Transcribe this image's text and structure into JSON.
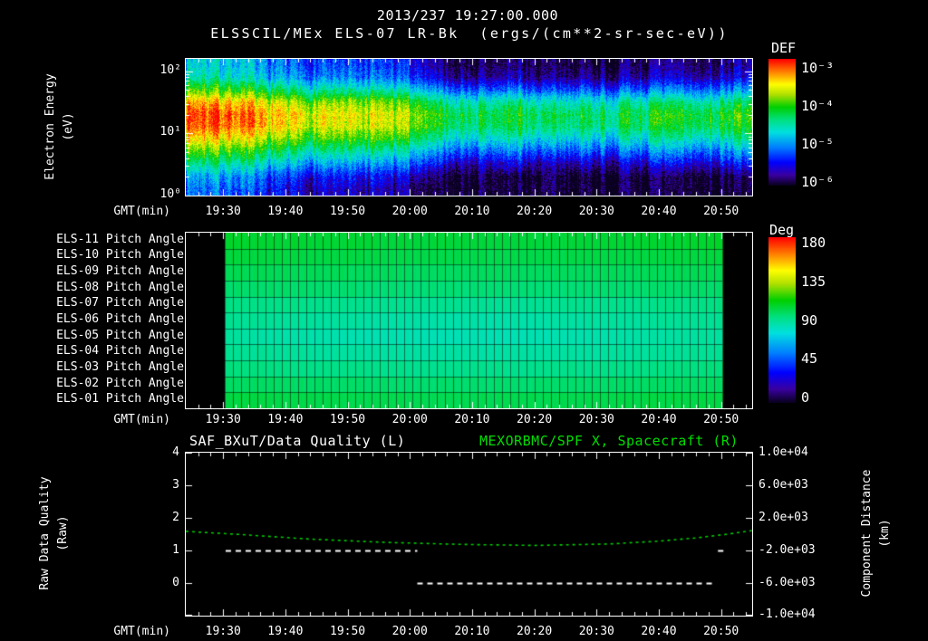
{
  "page": {
    "background": "#000000",
    "text_color": "#ffffff",
    "green": "#00dd00"
  },
  "header": {
    "datetime": "2013/237 19:27:00.000",
    "spectrogram_title": "ELSSCIL/MEx ELS-07 LR-Bk  (ergs/(cm**2-sr-sec-eV))"
  },
  "axes": {
    "time_label": "GMT(min)",
    "time_domain_minutes_after_1900": [
      24,
      115
    ],
    "time_tick_minutes": [
      30,
      40,
      50,
      60,
      70,
      80,
      90,
      100,
      110
    ],
    "time_ticks": [
      "19:30",
      "19:40",
      "19:50",
      "20:00",
      "20:10",
      "20:20",
      "20:30",
      "20:40",
      "20:50"
    ]
  },
  "spectrogram": {
    "ylabel": "Electron Energy\n(eV)",
    "y_ticks": [
      "10²",
      "10¹",
      "10⁰"
    ],
    "colorbar": {
      "label": "DEF",
      "ticks": [
        "10⁻³",
        "10⁻⁴",
        "10⁻⁵",
        "10⁻⁶"
      ]
    }
  },
  "pitch": {
    "row_labels": [
      "ELS-11 Pitch Angle",
      "ELS-10 Pitch Angle",
      "ELS-09 Pitch Angle",
      "ELS-08 Pitch Angle",
      "ELS-07 Pitch Angle",
      "ELS-06 Pitch Angle",
      "ELS-05 Pitch Angle",
      "ELS-04 Pitch Angle",
      "ELS-03 Pitch Angle",
      "ELS-02 Pitch Angle",
      "ELS-01 Pitch Angle"
    ],
    "colorbar": {
      "label": "Deg",
      "ticks": [
        "180",
        "135",
        "90",
        "45",
        "0"
      ]
    }
  },
  "quality": {
    "title_left": "SAF_BXuT/Data Quality (L)",
    "title_right": "MEXORBMC/SPF X, Spacecraft (R)",
    "ylabel_left": "Raw Data Quality\n(Raw)",
    "ylabel_right": "Component Distance\n(km)",
    "left_ticks": [
      "4",
      "3",
      "2",
      "1",
      "0"
    ],
    "right_ticks": [
      "1.0e+04",
      "6.0e+03",
      "2.0e+03",
      "-2.0e+03",
      "-6.0e+03",
      "-1.0e+04"
    ]
  },
  "colors": {
    "colormap": [
      [
        0.0,
        "#0a0020"
      ],
      [
        0.08,
        "#3a00a0"
      ],
      [
        0.18,
        "#0000ff"
      ],
      [
        0.3,
        "#0080ff"
      ],
      [
        0.42,
        "#00e0e0"
      ],
      [
        0.52,
        "#00e080"
      ],
      [
        0.62,
        "#00d000"
      ],
      [
        0.72,
        "#b0e000"
      ],
      [
        0.8,
        "#ffff00"
      ],
      [
        0.9,
        "#ff8000"
      ],
      [
        1.0,
        "#ff0000"
      ]
    ],
    "quality_line": "#ffffff",
    "distance_line": "#00cc00"
  },
  "chart_data": [
    {
      "type": "heatmap",
      "name": "electron_energy_spectrogram",
      "title": "ELSSCIL/MEx ELS-07 LR-Bk",
      "units": "ergs/(cm**2-sr-sec-eV)",
      "xlabel": "GMT(min)",
      "ylabel": "Electron Energy (eV)",
      "y_scale": "log",
      "ylim_log10_ev": [
        0,
        2.2
      ],
      "x_range_minutes_after_1900": [
        24,
        115
      ],
      "colorbar_label": "DEF",
      "colorbar_ticks_log10": [
        -3,
        -4,
        -5,
        -6
      ],
      "row_log10_energy": [
        2.1,
        1.9,
        1.7,
        1.5,
        1.3,
        1.1,
        0.9,
        0.7,
        0.5,
        0.3,
        0.1
      ],
      "values_log10_def": [
        [
          -4.9,
          -5.0,
          -5.3,
          -5.5,
          -5.5,
          -5.6,
          -5.6,
          -5.8,
          -6.2,
          -6.3,
          -6.1,
          -6.3,
          -6.2,
          -6.3,
          -6.2,
          -6.1,
          -6.2,
          -6.0
        ],
        [
          -4.7,
          -4.8,
          -5.1,
          -5.3,
          -5.3,
          -5.4,
          -5.4,
          -5.6,
          -6.0,
          -6.1,
          -5.9,
          -6.2,
          -6.0,
          -6.1,
          -6.0,
          -5.9,
          -6.0,
          -5.8
        ],
        [
          -4.1,
          -4.2,
          -4.5,
          -4.7,
          -4.7,
          -4.8,
          -4.8,
          -5.0,
          -5.4,
          -5.5,
          -5.3,
          -5.6,
          -5.4,
          -5.5,
          -5.4,
          -5.3,
          -5.4,
          -5.2
        ],
        [
          -3.4,
          -3.5,
          -3.8,
          -4.0,
          -4.0,
          -4.1,
          -4.1,
          -4.3,
          -4.7,
          -4.8,
          -4.6,
          -4.9,
          -4.7,
          -4.8,
          -4.7,
          -4.6,
          -4.7,
          -4.5
        ],
        [
          -3.1,
          -3.2,
          -3.5,
          -3.7,
          -3.7,
          -3.8,
          -3.8,
          -4.0,
          -4.4,
          -4.5,
          -4.3,
          -4.6,
          -4.4,
          -4.5,
          -4.4,
          -4.3,
          -4.4,
          -4.2
        ],
        [
          -3.2,
          -3.3,
          -3.6,
          -3.8,
          -3.8,
          -3.9,
          -3.9,
          -4.1,
          -4.5,
          -4.6,
          -4.4,
          -4.7,
          -4.5,
          -4.6,
          -4.5,
          -4.4,
          -4.5,
          -4.3
        ],
        [
          -3.6,
          -3.7,
          -4.0,
          -4.2,
          -4.2,
          -4.3,
          -4.3,
          -4.5,
          -4.9,
          -5.0,
          -4.8,
          -5.1,
          -4.9,
          -5.0,
          -4.9,
          -4.8,
          -4.9,
          -4.7
        ],
        [
          -4.1,
          -4.2,
          -4.5,
          -4.7,
          -4.7,
          -4.8,
          -4.8,
          -5.0,
          -5.4,
          -5.5,
          -5.3,
          -5.6,
          -5.4,
          -5.5,
          -5.4,
          -5.3,
          -5.4,
          -5.2
        ],
        [
          -4.6,
          -4.7,
          -5.0,
          -5.2,
          -5.2,
          -5.3,
          -5.3,
          -5.5,
          -5.9,
          -6.0,
          -5.8,
          -6.1,
          -5.9,
          -6.0,
          -5.9,
          -5.8,
          -5.9,
          -5.7
        ],
        [
          -5.1,
          -5.2,
          -5.5,
          -5.7,
          -5.7,
          -5.8,
          -5.8,
          -6.0,
          -6.3,
          -6.3,
          -6.3,
          -6.3,
          -6.3,
          -6.3,
          -6.3,
          -6.3,
          -6.3,
          -6.2
        ],
        [
          -5.3,
          -5.4,
          -5.7,
          -5.9,
          -5.9,
          -6.0,
          -6.0,
          -6.2,
          -6.3,
          -6.3,
          -6.3,
          -6.3,
          -6.3,
          -6.3,
          -6.3,
          -6.3,
          -6.3,
          -6.3
        ]
      ]
    },
    {
      "type": "heatmap",
      "name": "pitch_angles",
      "units": "Deg",
      "colorbar_range_deg": [
        0,
        180
      ],
      "data_t_range": [
        30.2,
        110.2
      ],
      "sample_t": [
        30,
        46,
        62,
        78,
        94,
        110
      ],
      "values_deg": [
        [
          105,
          104,
          103,
          103,
          104,
          105
        ],
        [
          103,
          102,
          101,
          101,
          102,
          103
        ],
        [
          100,
          99,
          98,
          98,
          99,
          100
        ],
        [
          97,
          96,
          95,
          95,
          96,
          97
        ],
        [
          93,
          91,
          90,
          90,
          91,
          93
        ],
        [
          90,
          88,
          86,
          86,
          88,
          90
        ],
        [
          88,
          85,
          84,
          84,
          86,
          88
        ],
        [
          90,
          88,
          87,
          87,
          88,
          90
        ],
        [
          94,
          92,
          91,
          91,
          92,
          94
        ],
        [
          98,
          97,
          96,
          96,
          97,
          98
        ],
        [
          102,
          101,
          100,
          100,
          101,
          102
        ]
      ]
    },
    {
      "type": "line",
      "name": "quality_and_distance",
      "left_axis": {
        "label": "Raw Data Quality (Raw)",
        "range": [
          -1,
          4
        ]
      },
      "right_axis": {
        "label": "Component Distance (km)",
        "range": [
          -10000,
          10000
        ]
      },
      "series": [
        {
          "name": "SAF_BXuT/Data Quality",
          "axis": "left",
          "color": "#ffffff",
          "style": "dashed",
          "segments": [
            {
              "t0": 30.4,
              "t1": 61.2,
              "value": 1
            },
            {
              "t0": 61.2,
              "t1": 108.9,
              "value": 0
            },
            {
              "t0": 109.5,
              "t1": 110.8,
              "value": 1
            }
          ]
        },
        {
          "name": "MEXORBMC/SPF X, Spacecraft",
          "axis": "right",
          "color": "#00cc00",
          "style": "dashed",
          "points": [
            [
              24,
              400
            ],
            [
              32,
              50
            ],
            [
              44,
              -550
            ],
            [
              56,
              -950
            ],
            [
              68,
              -1200
            ],
            [
              80,
              -1330
            ],
            [
              92,
              -1150
            ],
            [
              100,
              -800
            ],
            [
              106,
              -400
            ],
            [
              111,
              50
            ],
            [
              115,
              500
            ]
          ]
        }
      ]
    }
  ]
}
